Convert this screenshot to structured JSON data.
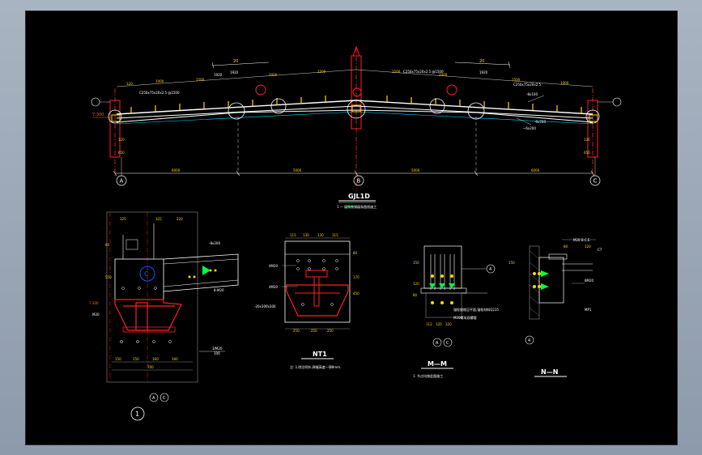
{
  "drawing": {
    "main_title": "GJL1D",
    "main_note": "1 — 檩条按钢檩条图纸施工",
    "axes": {
      "a": "A",
      "b": "B",
      "c": "C"
    },
    "slope": "20",
    "top_dims": {
      "left": "1920",
      "right": "1920"
    },
    "span_dims": {
      "left": "6000",
      "mid_left": "5000",
      "mid_right": "5000",
      "right": "6000"
    },
    "left_elev": "7.300",
    "rafter_notes": {
      "left": "-8x100",
      "right": "-8x100",
      "right2": "-6x200"
    },
    "detail_1": {
      "label": "1",
      "axes": "A C",
      "note1": "-8x200",
      "note2": "8-M20",
      "note3": "M20",
      "note4": "3/M20",
      "dim": "100"
    },
    "detail_nt1": {
      "title": "NT1",
      "note": "注: 1.除注明外,焊缝高度一律8mm.",
      "label1": "4M20",
      "label2": "4M20",
      "label3": "-20x300x300"
    },
    "detail_mm": {
      "title": "M—M",
      "note": "1. 节点均按此图施工",
      "axes": "A C",
      "label": "4",
      "text1": "锚栓规格见平面,锚栓材料Q235",
      "text2": "M20螺母双螺帽"
    },
    "detail_nn": {
      "title": "N—N",
      "label": "4",
      "text1": "M20 B.C.E",
      "text2": "C7",
      "text3": "8M20",
      "text4": "MP1"
    }
  }
}
